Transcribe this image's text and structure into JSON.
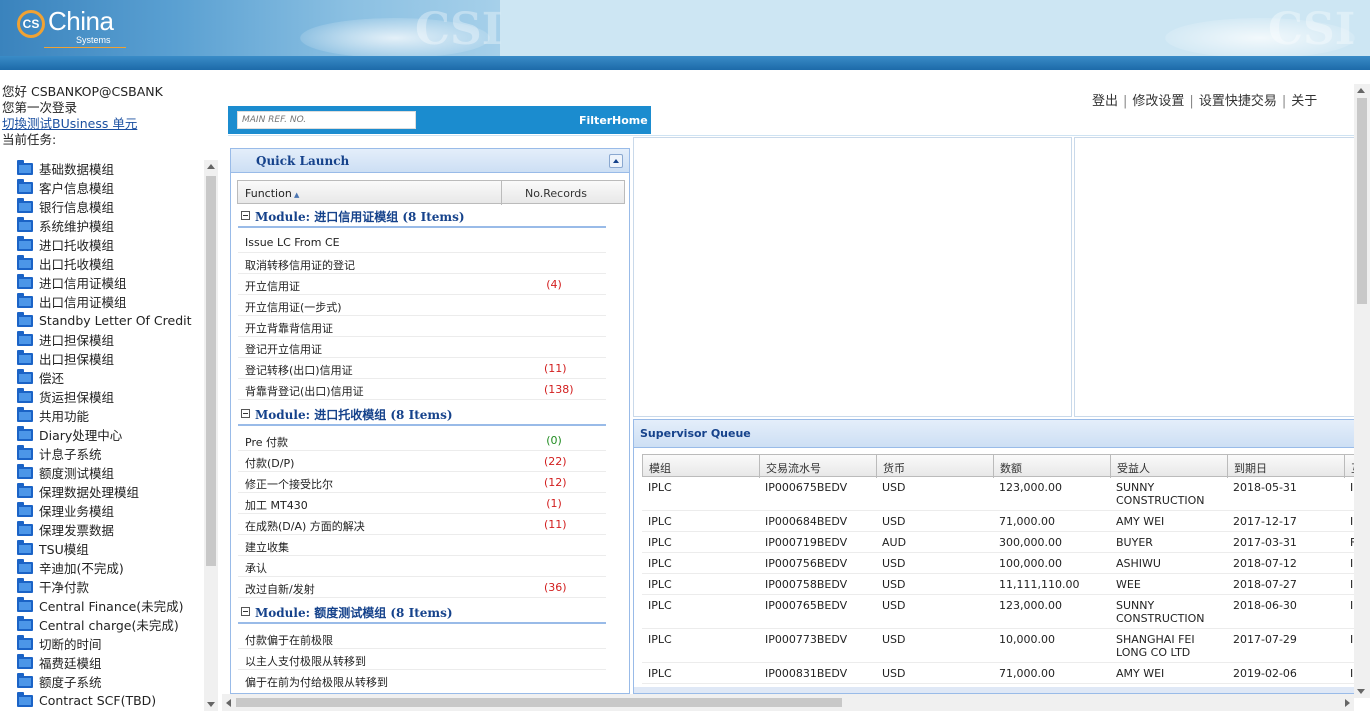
{
  "header": {
    "logo_mark": "CS",
    "logo_text": "China",
    "logo_sub": "Systems",
    "watermark": "CSI"
  },
  "user": {
    "greeting": "您好 CSBANKOP@CSBANK",
    "first_login": "您第一次登录",
    "switch_link": "切換测试BUsiness 单元",
    "current_task": "当前任务:"
  },
  "tree_items": [
    "基础数据模组",
    "客户信息模组",
    "银行信息模组",
    "系统维护模组",
    "进口托收模组",
    "出口托收模组",
    "进口信用证模组",
    "出口信用证模组",
    "Standby Letter Of Credit",
    "进口担保模组",
    "出口担保模组",
    "偿还",
    "货运担保模组",
    "共用功能",
    "Diary处理中心",
    "计息子系统",
    "额度测试模组",
    "保理数据处理模组",
    "保理业务模组",
    "保理发票数据",
    "TSU模组",
    "辛迪加(不完成)",
    "干净付款",
    "Central Finance(未完成)",
    "Central charge(未完成)",
    "切断的时间",
    "福费廷模组",
    "额度子系统",
    "Contract SCF(TBD)"
  ],
  "top_links": [
    "登出",
    "修改设置",
    "设置快捷交易",
    "关于"
  ],
  "search": {
    "placeholder": "MAIN REF. NO.",
    "filter_label": "Filter",
    "home_label": "Home"
  },
  "quick_launch": {
    "title": "Quick Launch",
    "col_function": "Function",
    "col_records": "No.Records",
    "modules": [
      {
        "title": "Module: 进口信用证模组 (8 Items)",
        "rows": [
          {
            "name": "Issue LC From CE",
            "count": ""
          },
          {
            "name": "取消转移信用证的登记",
            "count": ""
          },
          {
            "name": "开立信用证",
            "count": "(4)"
          },
          {
            "name": "开立信用证(一步式)",
            "count": ""
          },
          {
            "name": "开立背靠背信用证",
            "count": ""
          },
          {
            "name": "登记开立信用证",
            "count": ""
          },
          {
            "name": "登记转移(出口)信用证",
            "count": "(11)"
          },
          {
            "name": "背靠背登记(出口)信用证",
            "count": "(138)"
          }
        ]
      },
      {
        "title": "Module: 进口托收模组 (8 Items)",
        "rows": [
          {
            "name": "Pre 付款",
            "count": "(0)"
          },
          {
            "name": "付款(D/P)",
            "count": "(22)"
          },
          {
            "name": "修正一个接受比尔",
            "count": "(12)"
          },
          {
            "name": "加工 MT430",
            "count": "(1)"
          },
          {
            "name": "在成熟(D/A) 方面的解决",
            "count": "(11)"
          },
          {
            "name": "建立收集",
            "count": ""
          },
          {
            "name": "承认",
            "count": ""
          },
          {
            "name": "改过自新/发射",
            "count": "(36)"
          }
        ]
      },
      {
        "title": "Module: 额度测试模组 (8 Items)",
        "rows": [
          {
            "name": "付款偏于在前极限",
            "count": ""
          },
          {
            "name": "以主人支付极限从转移到",
            "count": ""
          },
          {
            "name": "偏于在前为付给极限从转移到",
            "count": ""
          }
        ]
      }
    ]
  },
  "supervisor_queue": {
    "title": "Supervisor Queue",
    "columns": [
      "模组",
      "交易流水号",
      "货币",
      "数额",
      "受益人",
      "到期日",
      "互"
    ],
    "rows": [
      [
        "IPLC",
        "IP000675BEDV",
        "USD",
        "123,000.00",
        "SUNNY CONSTRUCTION",
        "2018-05-31",
        "I"
      ],
      [
        "IPLC",
        "IP000684BEDV",
        "USD",
        "71,000.00",
        "AMY WEI",
        "2017-12-17",
        "I"
      ],
      [
        "IPLC",
        "IP000719BEDV",
        "AUD",
        "300,000.00",
        "BUYER",
        "2017-03-31",
        "F"
      ],
      [
        "IPLC",
        "IP000756BEDV",
        "USD",
        "100,000.00",
        "ASHIWU",
        "2018-07-12",
        "I"
      ],
      [
        "IPLC",
        "IP000758BEDV",
        "USD",
        "11,111,110.00",
        "WEE",
        "2018-07-27",
        "I"
      ],
      [
        "IPLC",
        "IP000765BEDV",
        "USD",
        "123,000.00",
        "SUNNY CONSTRUCTION",
        "2018-06-30",
        "I"
      ],
      [
        "IPLC",
        "IP000773BEDV",
        "USD",
        "10,000.00",
        "SHANGHAI FEI LONG CO LTD",
        "2017-07-29",
        "I"
      ],
      [
        "IPLC",
        "IP000831BEDV",
        "USD",
        "71,000.00",
        "AMY WEI",
        "2019-02-06",
        "I"
      ]
    ]
  },
  "colors": {
    "brand_blue": "#1b8ccf",
    "panel_title": "#15428b",
    "count_red": "#d21e1e",
    "count_green": "#218c21"
  }
}
